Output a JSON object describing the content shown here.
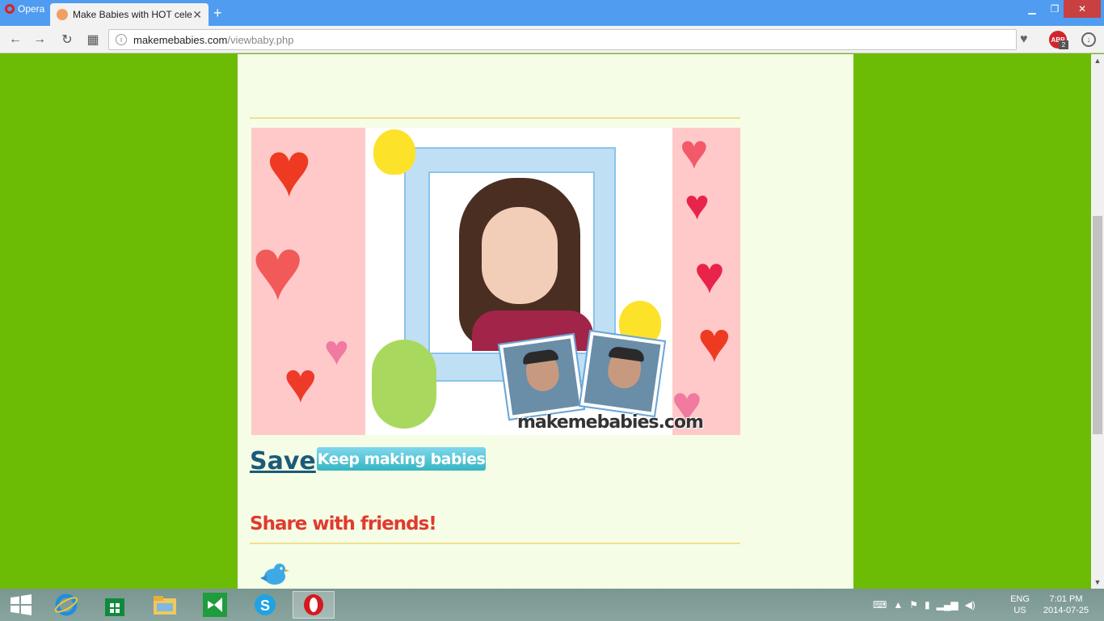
{
  "browser": {
    "menu_label": "Opera",
    "tab_title": "Make Babies with HOT cele",
    "new_tab": "+",
    "url_host": "makemebabies.com",
    "url_path": "/viewbaby.php"
  },
  "page": {
    "save_label": "Save",
    "keep_button": "Keep making babies",
    "share_title": "Share with friends!",
    "watermark": "makemebabies.com"
  },
  "extensions": {
    "abp_label": "ABP",
    "abp_count": "2"
  },
  "taskbar": {
    "lang_line1": "ENG",
    "lang_line2": "US",
    "time": "7:01 PM",
    "date": "2014-07-25"
  },
  "colors": {
    "page_background": "#6cbc06",
    "content_background": "#f5fde6",
    "share_title": "#e03a2e",
    "save_link": "#1c5a78",
    "titlebar": "#4f9cf0"
  }
}
